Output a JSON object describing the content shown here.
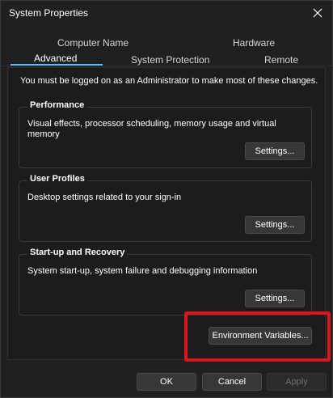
{
  "window": {
    "title": "System Properties"
  },
  "tabs": {
    "row1": [
      {
        "label": "Computer Name"
      },
      {
        "label": "Hardware"
      }
    ],
    "row2": [
      {
        "label": "Advanced",
        "active": true
      },
      {
        "label": "System Protection"
      },
      {
        "label": "Remote"
      }
    ]
  },
  "advanced": {
    "admin_note": "You must be logged on as an Administrator to make most of these changes.",
    "performance": {
      "title": "Performance",
      "description": "Visual effects, processor scheduling, memory usage and virtual memory",
      "button": "Settings..."
    },
    "user_profiles": {
      "title": "User Profiles",
      "description": "Desktop settings related to your sign-in",
      "button": "Settings..."
    },
    "startup_recovery": {
      "title": "Start-up and Recovery",
      "description": "System start-up, system failure and debugging information",
      "button": "Settings..."
    },
    "env_vars_button": "Environment Variables..."
  },
  "footer": {
    "ok": "OK",
    "cancel": "Cancel",
    "apply": "Apply"
  },
  "colors": {
    "accent": "#4cc2ff",
    "highlight": "#e0141b"
  },
  "icons": {
    "close": "close-icon"
  }
}
